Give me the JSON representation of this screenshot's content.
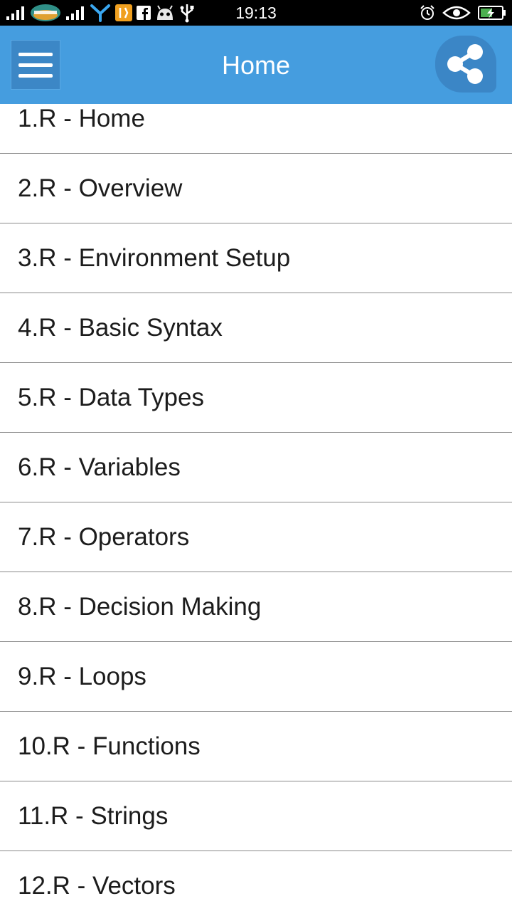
{
  "status_bar": {
    "time": "19:13",
    "left_icons": [
      "signal-bars-icon",
      "viettel-carrier-icon",
      "signal-bars-icon",
      "network-share-icon",
      "tools-app-icon",
      "facebook-icon",
      "android-icon",
      "usb-icon"
    ],
    "right_icons": [
      "alarm-icon",
      "eye-icon",
      "battery-charging-icon"
    ]
  },
  "app_bar": {
    "title": "Home",
    "color": "#459ddf",
    "menu_icon": "hamburger-menu-icon",
    "share_icon": "share-icon"
  },
  "list": {
    "items": [
      {
        "label": "1.R - Home"
      },
      {
        "label": "2.R - Overview"
      },
      {
        "label": "3.R - Environment Setup"
      },
      {
        "label": "4.R - Basic Syntax"
      },
      {
        "label": "5.R - Data Types"
      },
      {
        "label": "6.R - Variables"
      },
      {
        "label": "7.R - Operators"
      },
      {
        "label": "8.R - Decision Making"
      },
      {
        "label": "9.R - Loops"
      },
      {
        "label": "10.R - Functions"
      },
      {
        "label": "11.R - Strings"
      },
      {
        "label": "12.R - Vectors"
      }
    ]
  }
}
